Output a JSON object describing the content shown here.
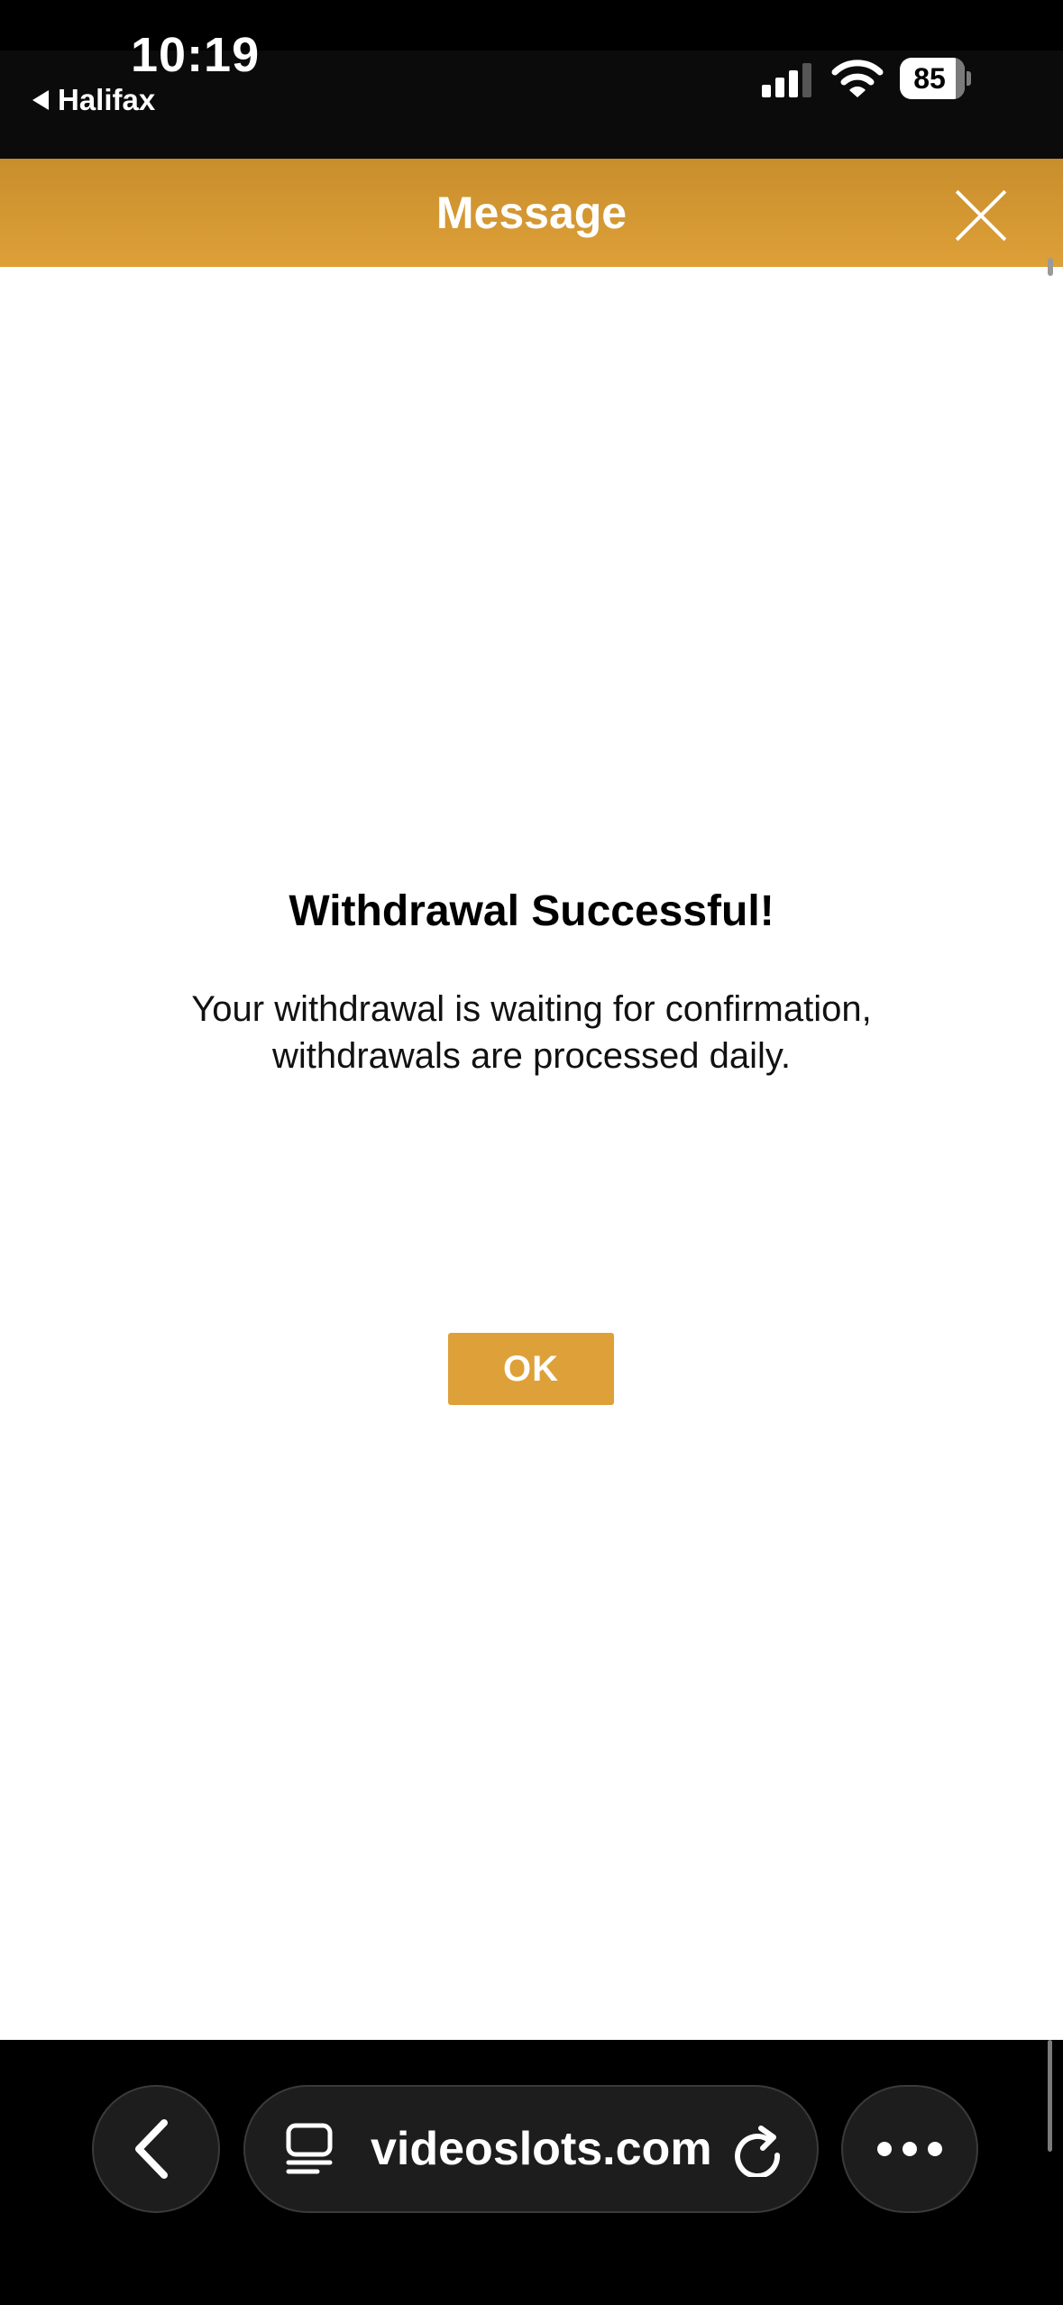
{
  "status_bar": {
    "time": "10:19",
    "back_app": "Halifax",
    "battery": "85"
  },
  "header": {
    "title": "Message"
  },
  "message": {
    "title": "Withdrawal Successful!",
    "body": "Your withdrawal is waiting for confirmation, withdrawals are processed daily.",
    "ok_label": "OK"
  },
  "browser": {
    "url": "videoslots.com"
  },
  "colors": {
    "accent": "#dea038",
    "header_dark": "#c88e2c",
    "content_bg": "#ffffff",
    "chrome_bg": "#000000"
  },
  "icons": {
    "close": "close-icon",
    "back": "chevron-left-icon",
    "tabs": "tabs-icon",
    "reload": "reload-icon",
    "more": "more-icon",
    "signal": "cellular-signal-icon",
    "wifi": "wifi-icon",
    "battery": "battery-icon"
  }
}
